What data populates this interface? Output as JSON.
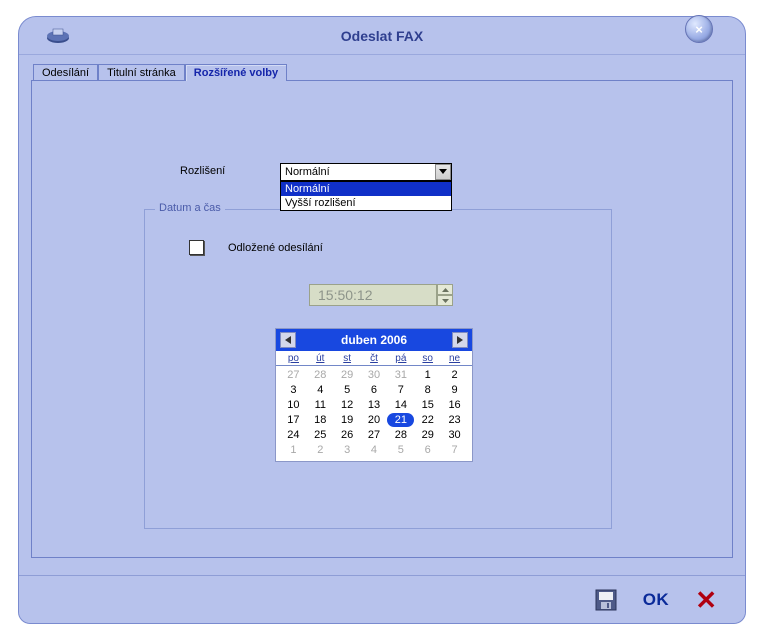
{
  "window": {
    "title": "Odeslat FAX",
    "close_icon": "×"
  },
  "tabs": {
    "t0": "Odesílání",
    "t1": "Titulní stránka",
    "t2": "Rozšířené volby"
  },
  "resolution": {
    "label": "Rozlišení",
    "value": "Normální",
    "options": {
      "o0": "Normální",
      "o1": "Vyšší rozlišení"
    }
  },
  "datetime": {
    "legend": "Datum a čas",
    "delayed_label": "Odložené odesílání",
    "time_value": "15:50:12"
  },
  "calendar": {
    "title": "duben 2006",
    "dow": {
      "d0": "po",
      "d1": "út",
      "d2": "st",
      "d3": "čt",
      "d4": "pá",
      "d5": "so",
      "d6": "ne"
    },
    "cells": {
      "c0": "27",
      "c1": "28",
      "c2": "29",
      "c3": "30",
      "c4": "31",
      "c5": "1",
      "c6": "2",
      "c7": "3",
      "c8": "4",
      "c9": "5",
      "c10": "6",
      "c11": "7",
      "c12": "8",
      "c13": "9",
      "c14": "10",
      "c15": "11",
      "c16": "12",
      "c17": "13",
      "c18": "14",
      "c19": "15",
      "c20": "16",
      "c21": "17",
      "c22": "18",
      "c23": "19",
      "c24": "20",
      "c25": "21",
      "c26": "22",
      "c27": "23",
      "c28": "24",
      "c29": "25",
      "c30": "26",
      "c31": "27",
      "c32": "28",
      "c33": "29",
      "c34": "30",
      "c35": "1",
      "c36": "2",
      "c37": "3",
      "c38": "4",
      "c39": "5",
      "c40": "6",
      "c41": "7"
    },
    "muted_indices": [
      0,
      1,
      2,
      3,
      4,
      35,
      36,
      37,
      38,
      39,
      40,
      41
    ],
    "today_index": 25
  },
  "buttons": {
    "ok": "OK",
    "cancel": "✕"
  }
}
